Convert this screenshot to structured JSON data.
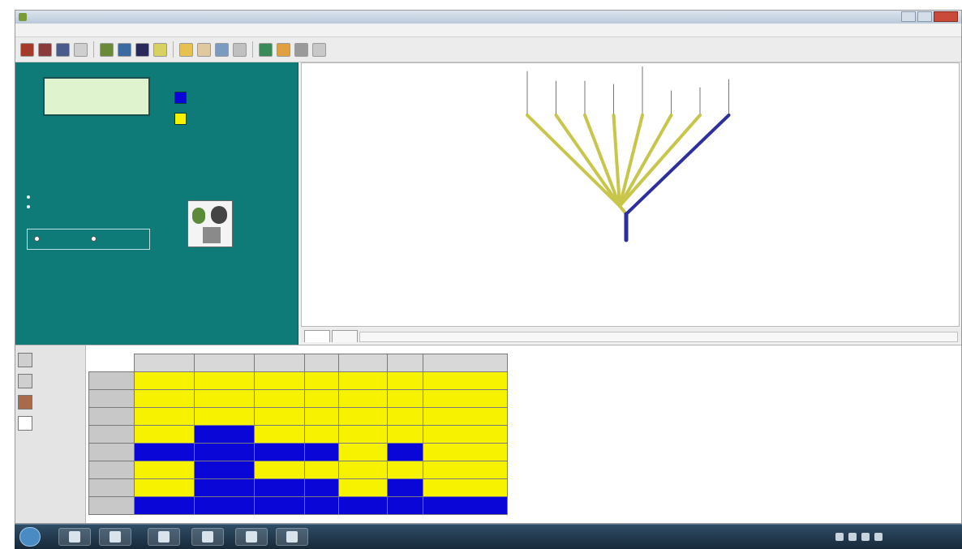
{
  "slide": {
    "title": ""
  },
  "window": {
    "title": ""
  },
  "menu": [
    "",
    "",
    "",
    "",
    "",
    "",
    "",
    "",
    "",
    "",
    "",
    ""
  ],
  "toolbar": {
    "buttons": [
      {
        "name": "toolbar-button-1",
        "color": "#a33a2a"
      },
      {
        "name": "toolbar-button-2",
        "color": "#8a3a3a"
      },
      {
        "name": "toolbar-button-3",
        "color": "#4a5a8a"
      },
      {
        "name": "toolbar-button-4",
        "color": "#cfcfcf"
      },
      {
        "name": "toolbar-button-5",
        "color": "#6a8a3a"
      },
      {
        "name": "toolbar-button-6",
        "color": "#3a6aa0"
      },
      {
        "name": "toolbar-button-7",
        "color": "#2a2a5a"
      },
      {
        "name": "toolbar-button-8",
        "color": "#d8d060"
      },
      {
        "name": "toolbar-button-9",
        "color": "#e6c050"
      },
      {
        "name": "toolbar-button-10",
        "color": "#e0c8a0"
      },
      {
        "name": "toolbar-button-11",
        "color": "#7a9ac0"
      },
      {
        "name": "toolbar-button-12",
        "color": "#c0c0c0"
      },
      {
        "name": "toolbar-button-13",
        "color": "#3a8a5a"
      },
      {
        "name": "toolbar-button-14",
        "color": "#e0a040"
      },
      {
        "name": "toolbar-button-15",
        "color": "#9a9a9a"
      },
      {
        "name": "toolbar-button-16",
        "color": "#c8c8c8"
      }
    ]
  },
  "left_panel": {
    "callout": "",
    "legend_title": "",
    "legend": [
      {
        "label": "",
        "color": "#0b06d8"
      },
      {
        "label": "",
        "color": "#f6f200"
      }
    ],
    "info_text": "",
    "bullets": [
      "",
      ""
    ],
    "radio_group_label": "",
    "radio_options": [
      "",
      ""
    ]
  },
  "tree": {
    "taxa": [
      "",
      "",
      "",
      "",
      "",
      "",
      "",
      ""
    ],
    "yellow_color": "#c8c64a",
    "blue_color": "#2d2f9e"
  },
  "tabs": [
    "",
    ""
  ],
  "side_nav": [
    "",
    "",
    "",
    ""
  ],
  "table": {
    "columns": [
      "",
      "",
      "",
      "",
      "",
      "",
      ""
    ],
    "rows": [
      {
        "name": "",
        "cells": [
          {
            "value": "",
            "fill": "yellow"
          },
          {
            "value": "",
            "fill": "yellow"
          },
          {
            "value": "",
            "fill": "yellow"
          },
          {
            "value": "",
            "fill": "yellow"
          },
          {
            "value": "",
            "fill": "yellow"
          },
          {
            "value": "",
            "fill": "yellow"
          },
          {
            "value": "",
            "fill": "yellow"
          }
        ]
      },
      {
        "name": "",
        "cells": [
          {
            "value": "",
            "fill": "yellow"
          },
          {
            "value": "",
            "fill": "yellow"
          },
          {
            "value": "",
            "fill": "yellow"
          },
          {
            "value": "",
            "fill": "yellow"
          },
          {
            "value": "",
            "fill": "yellow"
          },
          {
            "value": "",
            "fill": "yellow"
          },
          {
            "value": "",
            "fill": "yellow"
          }
        ]
      },
      {
        "name": "",
        "cells": [
          {
            "value": "",
            "fill": "yellow"
          },
          {
            "value": "",
            "fill": "yellow"
          },
          {
            "value": "",
            "fill": "yellow"
          },
          {
            "value": "",
            "fill": "yellow"
          },
          {
            "value": "",
            "fill": "yellow"
          },
          {
            "value": "",
            "fill": "yellow"
          },
          {
            "value": "",
            "fill": "yellow"
          }
        ]
      },
      {
        "name": "",
        "cells": [
          {
            "value": "",
            "fill": "yellow"
          },
          {
            "value": "",
            "fill": "blue"
          },
          {
            "value": "",
            "fill": "yellow"
          },
          {
            "value": "",
            "fill": "yellow"
          },
          {
            "value": "",
            "fill": "yellow"
          },
          {
            "value": "",
            "fill": "yellow"
          },
          {
            "value": "",
            "fill": "yellow"
          }
        ]
      },
      {
        "name": "",
        "cells": [
          {
            "value": "",
            "fill": "blue"
          },
          {
            "value": "",
            "fill": "blue"
          },
          {
            "value": "",
            "fill": "blue"
          },
          {
            "value": "",
            "fill": "blue"
          },
          {
            "value": "",
            "fill": "yellow"
          },
          {
            "value": "",
            "fill": "blue"
          },
          {
            "value": "",
            "fill": "yellow"
          }
        ]
      },
      {
        "name": "",
        "cells": [
          {
            "value": "",
            "fill": "yellow"
          },
          {
            "value": "",
            "fill": "blue"
          },
          {
            "value": "",
            "fill": "yellow"
          },
          {
            "value": "",
            "fill": "yellow"
          },
          {
            "value": "",
            "fill": "yellow"
          },
          {
            "value": "",
            "fill": "yellow"
          },
          {
            "value": "",
            "fill": "yellow"
          }
        ]
      },
      {
        "name": "",
        "cells": [
          {
            "value": "",
            "fill": "yellow"
          },
          {
            "value": "",
            "fill": "blue"
          },
          {
            "value": "",
            "fill": "blue"
          },
          {
            "value": "",
            "fill": "blue"
          },
          {
            "value": "",
            "fill": "yellow"
          },
          {
            "value": "",
            "fill": "blue"
          },
          {
            "value": "",
            "fill": "yellow"
          }
        ]
      },
      {
        "name": "",
        "cells": [
          {
            "value": "",
            "fill": "blue"
          },
          {
            "value": "",
            "fill": "blue"
          },
          {
            "value": "",
            "fill": "blue"
          },
          {
            "value": "",
            "fill": "blue"
          },
          {
            "value": "",
            "fill": "blue"
          },
          {
            "value": "",
            "fill": "blue"
          },
          {
            "value": "",
            "fill": "blue"
          }
        ]
      }
    ]
  },
  "taskbar": {
    "apps": [
      {
        "name": "taskbar-app-1",
        "icon": "internet-explorer-icon"
      },
      {
        "name": "taskbar-app-2",
        "icon": "file-explorer-icon"
      },
      {
        "name": "taskbar-app-3",
        "icon": "phylogene-icon"
      },
      {
        "name": "taskbar-app-4",
        "icon": "word-icon"
      },
      {
        "name": "taskbar-app-5",
        "icon": "media-player-icon"
      },
      {
        "name": "taskbar-app-6",
        "icon": "document-icon"
      }
    ],
    "clock": ""
  }
}
